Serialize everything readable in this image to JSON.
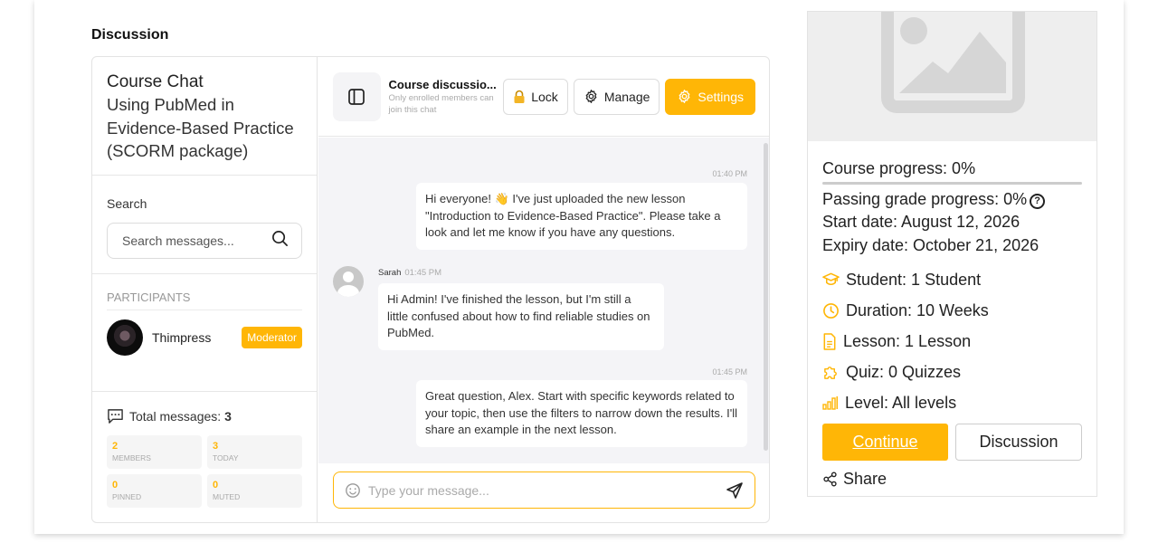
{
  "section": {
    "title": "Discussion"
  },
  "sidebar": {
    "course_chat_label": "Course Chat",
    "course_name": "Using PubMed in Evidence-Based Practice (SCORM package)",
    "search_label": "Search",
    "search_placeholder": "Search messages...",
    "participants_label": "PARTICIPANTS",
    "participant": {
      "name": "Thimpress",
      "role": "Moderator"
    },
    "total_messages_label": "Total messages:",
    "total_messages_value": "3",
    "stats": [
      {
        "value": "2",
        "label": "MEMBERS"
      },
      {
        "value": "3",
        "label": "TODAY"
      },
      {
        "value": "0",
        "label": "PINNED"
      },
      {
        "value": "0",
        "label": "MUTED"
      }
    ]
  },
  "chat_header": {
    "title": "Course discussio...",
    "subtitle": "Only enrolled members can join this chat",
    "lock_label": "Lock",
    "manage_label": "Manage",
    "settings_label": "Settings"
  },
  "messages": [
    {
      "time": "01:40 PM",
      "text": "Hi everyone! 👋 I've just uploaded the new lesson \"Introduction to Evidence-Based Practice\". Please take a look and let me know if you have any questions."
    },
    {
      "sender": "Sarah",
      "time": "01:45 PM",
      "text": "Hi Admin! I've finished the lesson, but I'm still a little confused about how to find reliable studies on PubMed."
    },
    {
      "time": "01:45 PM",
      "text": "Great question, Alex. Start with specific keywords related to your topic, then use the filters to narrow down the results. I'll share an example in the next lesson."
    }
  ],
  "composer": {
    "placeholder": "Type your message..."
  },
  "course_info": {
    "progress_text": "Course progress: 0%",
    "progress_value": 0,
    "passing_text": "Passing grade progress: 0%",
    "help_glyph": "?",
    "start_date": "Start date: August 12, 2026",
    "expiry_date": "Expiry date: October 21, 2026",
    "student": "Student: 1 Student",
    "duration": "Duration: 10 Weeks",
    "lesson": "Lesson: 1 Lesson",
    "quiz": "Quiz: 0 Quizzes",
    "level": "Level: All levels",
    "continue_label": "Continue",
    "discussion_label": "Discussion",
    "share_label": "Share"
  },
  "colors": {
    "accent": "#ffb606",
    "border": "#e3e3e3",
    "chat_bg": "#f4f4f7"
  },
  "icons": [
    "sidebar-toggle-icon",
    "lock-icon",
    "gear-icon",
    "search-icon",
    "chat-icon",
    "emoji-icon",
    "send-icon",
    "image-placeholder-icon",
    "graduation-cap-icon",
    "clock-icon",
    "document-icon",
    "puzzle-icon",
    "bar-chart-icon",
    "share-icon",
    "help-icon"
  ]
}
